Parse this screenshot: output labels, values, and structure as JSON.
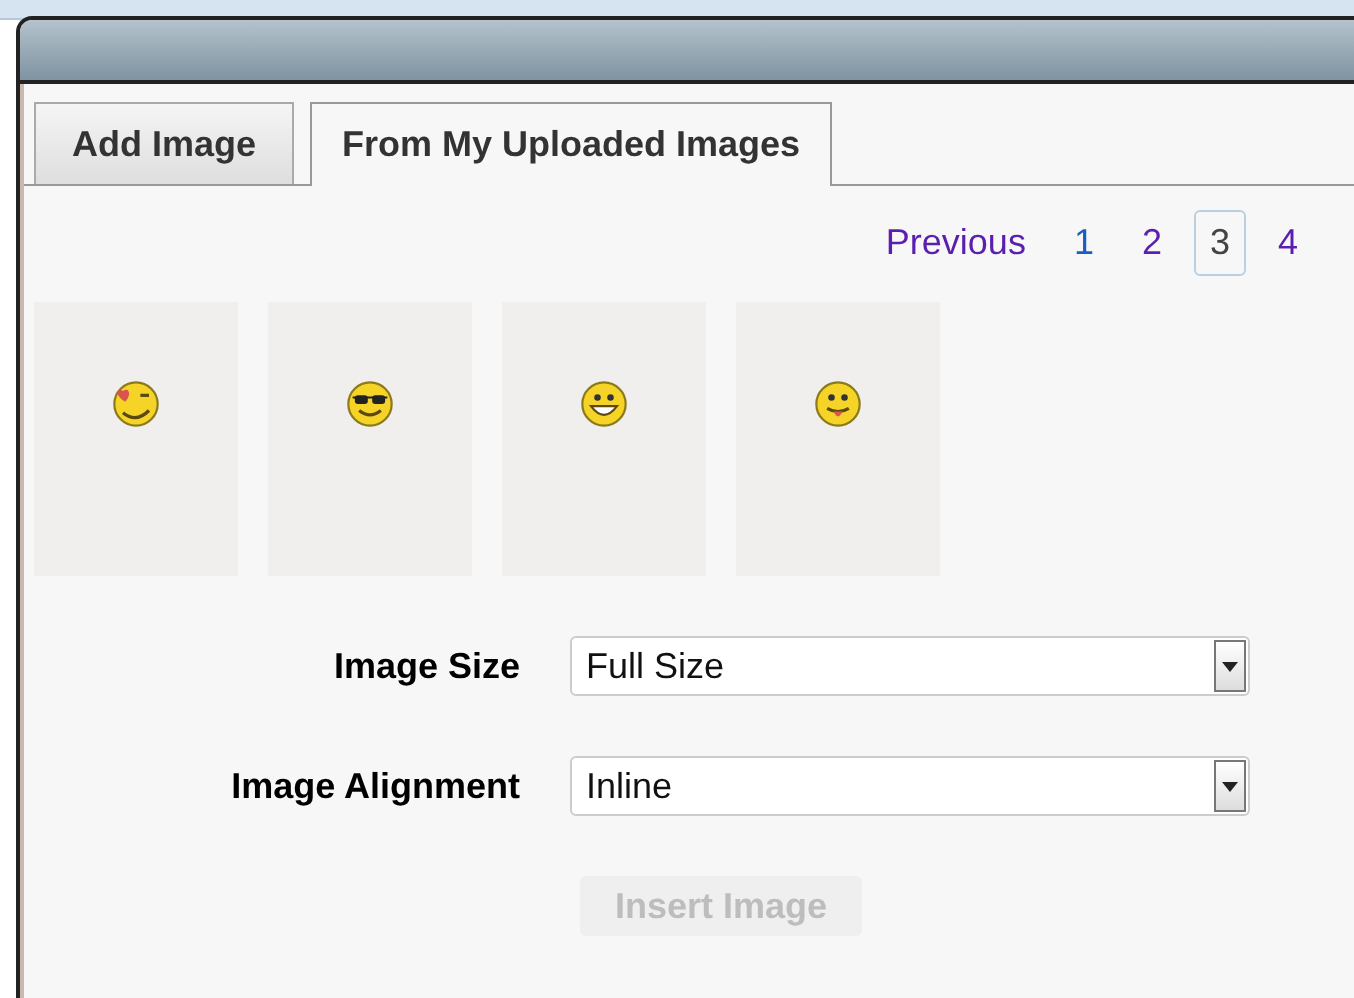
{
  "tabs": [
    {
      "label": "Add Image",
      "selected": false
    },
    {
      "label": "From My Uploaded Images",
      "selected": true
    }
  ],
  "pagination": [
    {
      "label": "Previous",
      "visited": true,
      "selected": false
    },
    {
      "label": "1",
      "visited": false,
      "selected": false
    },
    {
      "label": "2",
      "visited": true,
      "selected": false
    },
    {
      "label": "3",
      "visited": false,
      "selected": true
    },
    {
      "label": "4",
      "visited": true,
      "selected": false
    }
  ],
  "images": [
    {
      "kind": "heart"
    },
    {
      "kind": "cool"
    },
    {
      "kind": "grin"
    },
    {
      "kind": "tongue"
    }
  ],
  "fields": [
    {
      "label": "Image Size",
      "value": "Full Size"
    },
    {
      "label": "Image Alignment",
      "value": "Inline"
    }
  ],
  "insert_button": {
    "label": "Insert Image",
    "disabled": true
  }
}
